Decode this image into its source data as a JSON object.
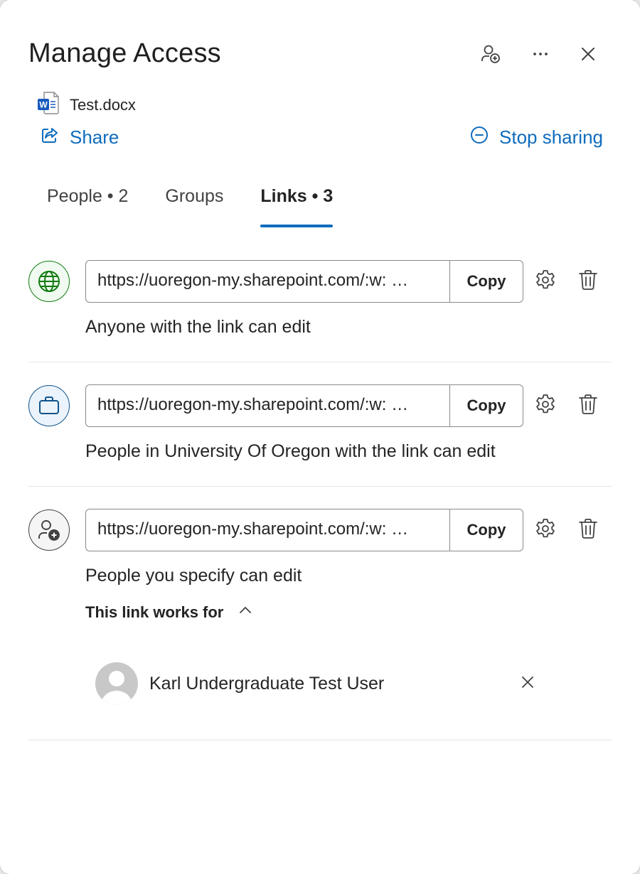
{
  "header": {
    "title": "Manage Access"
  },
  "file": {
    "name": "Test.docx",
    "icon": "word-doc-icon"
  },
  "actions": {
    "share_label": "Share",
    "stop_sharing_label": "Stop sharing"
  },
  "tabs": [
    {
      "label": "People • 2",
      "active": false
    },
    {
      "label": "Groups",
      "active": false
    },
    {
      "label": "Links • 3",
      "active": true
    }
  ],
  "links": [
    {
      "icon": "globe-icon",
      "url": "https://uoregon-my.sharepoint.com/:w: …",
      "copy_label": "Copy",
      "description": "Anyone with the link can edit",
      "accent": "#107c10"
    },
    {
      "icon": "briefcase-icon",
      "url": "https://uoregon-my.sharepoint.com/:w: …",
      "copy_label": "Copy",
      "description": "People in University Of Oregon with the link can edit",
      "accent": "#0f548c"
    },
    {
      "icon": "person-add-icon",
      "url": "https://uoregon-my.sharepoint.com/:w: …",
      "copy_label": "Copy",
      "description": "People you specify can edit",
      "accent": "#424242"
    }
  ],
  "works_for": {
    "label": "This link works for",
    "people": [
      {
        "name": "Karl Undergraduate Test User"
      }
    ]
  },
  "colors": {
    "brand": "#0f6cbd",
    "text": "#242424"
  }
}
